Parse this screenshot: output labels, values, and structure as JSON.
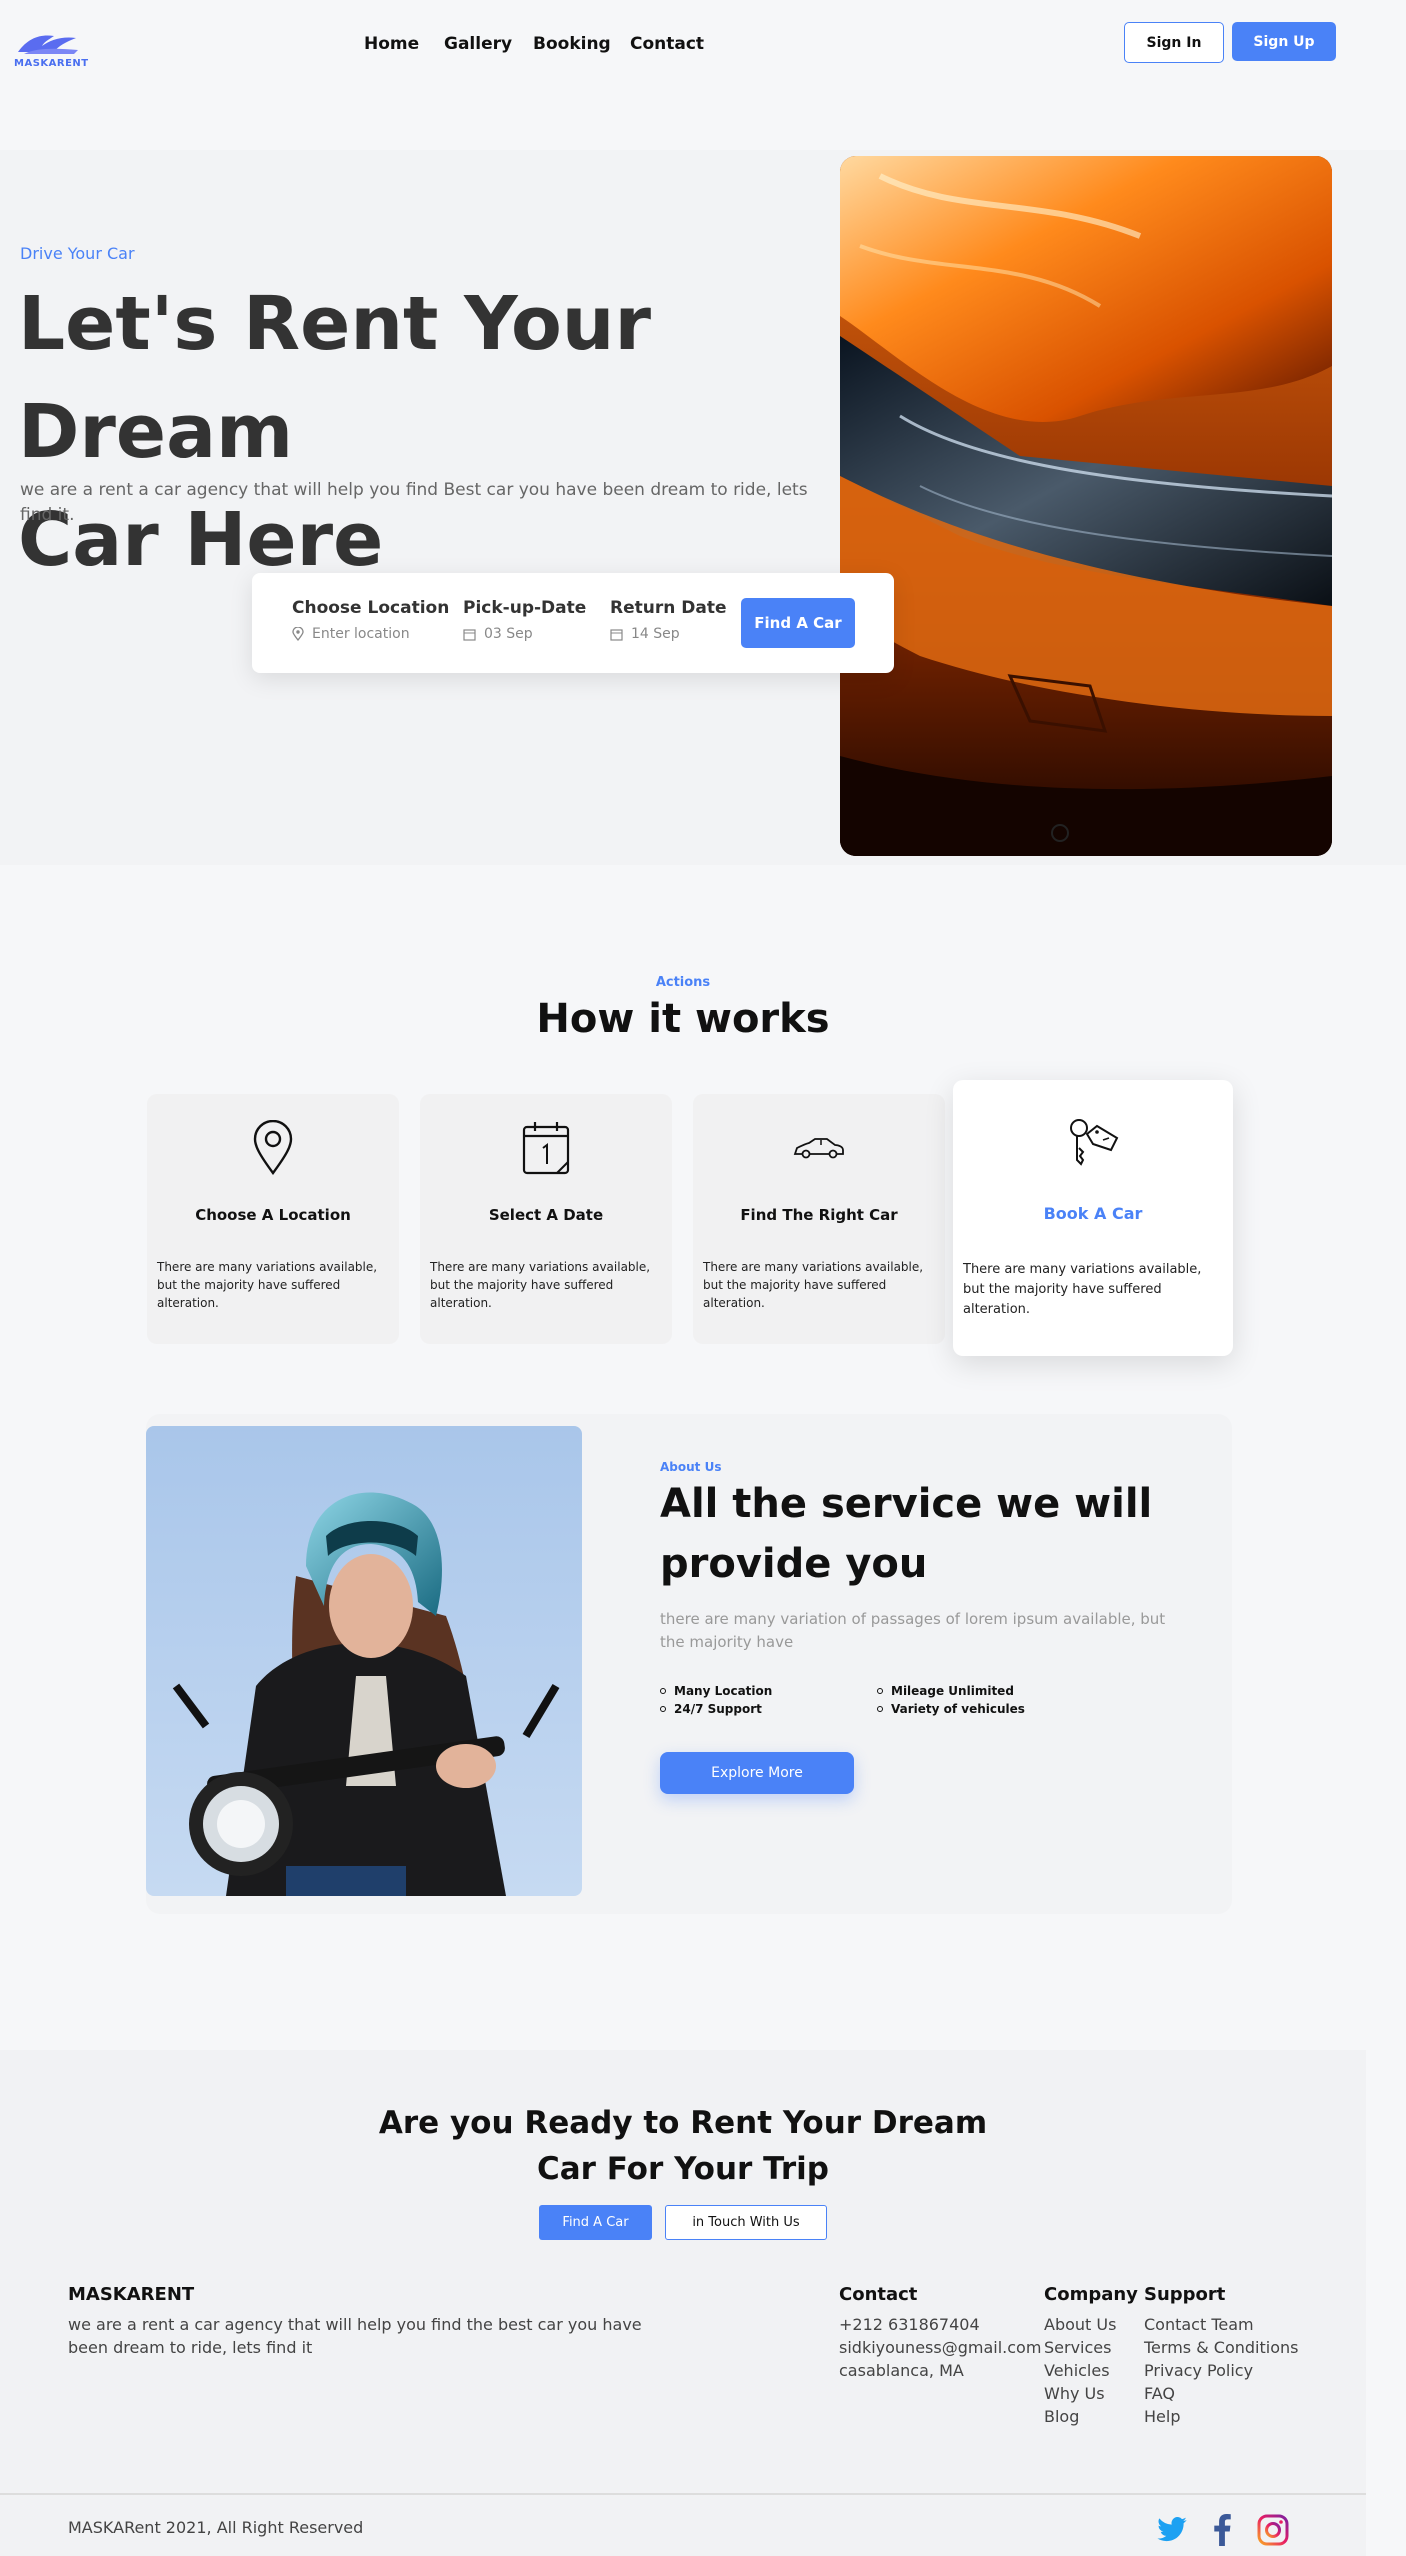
{
  "brand": {
    "name": "MASKARENT"
  },
  "nav": {
    "items": [
      "Home",
      "Gallery",
      "Booking",
      "Contact"
    ],
    "sign_in": "Sign In",
    "sign_up": "Sign Up"
  },
  "hero": {
    "eyebrow": "Drive Your Car",
    "title_line1": "Let's Rent Your Dream",
    "title_line2": "Car Here",
    "description": "we are a rent a car agency that will help you find Best car you have been dream to ride, lets find it.",
    "search": {
      "location_title": "Choose Location",
      "location_placeholder": "Enter location",
      "pickup_title": "Pick-up-Date",
      "pickup_value": "03 Sep",
      "return_title": "Return Date",
      "return_value": "14 Sep",
      "button": "Find A Car"
    }
  },
  "how": {
    "eyebrow": "Actions",
    "title": "How it works",
    "cards": [
      {
        "title": "Choose A Location",
        "desc": "There are many variations available, but the majority have suffered alteration.",
        "icon": "map-pin-icon"
      },
      {
        "title": "Select A Date",
        "desc": "There are many variations available, but the majority have suffered alteration.",
        "icon": "calendar-icon"
      },
      {
        "title": "Find The Right Car",
        "desc": "There are many variations available, but the majority have suffered alteration.",
        "icon": "car-icon"
      },
      {
        "title": "Book A Car",
        "desc": "There are many variations available, but the majority have suffered alteration.",
        "icon": "car-keys-icon"
      }
    ]
  },
  "about": {
    "eyebrow": "About Us",
    "title": "All the service we will provide you",
    "description": "there are many variation of passages of lorem ipsum available, but the majority have",
    "features": [
      "Many Location",
      "24/7 Support",
      "Mileage Unlimited",
      "Variety of vehicules"
    ],
    "button": "Explore More"
  },
  "cta": {
    "title_line1": "Are you Ready to Rent Your Dream",
    "title_line2": "Car For Your Trip",
    "find_button": "Find A Car",
    "touch_button": "in Touch With Us"
  },
  "footer": {
    "brand": "MASKARENT",
    "brand_desc": "we are a rent a car agency that will help you find the best car you have been dream to ride, lets find it",
    "contact": {
      "title": "Contact",
      "items": [
        "+212 631867404",
        "sidkiyouness@gmail.com",
        "casablanca, MA"
      ]
    },
    "company": {
      "title": "Company",
      "items": [
        "About Us",
        "Services",
        "Vehicles",
        "Why Us",
        "Blog"
      ]
    },
    "support": {
      "title": "Support",
      "items": [
        "Contact Team",
        "Terms & Conditions",
        "Privacy Policy",
        "FAQ",
        "Help"
      ]
    },
    "copyright": "MASKARent 2021, All Right Reserved"
  },
  "colors": {
    "accent": "#4a82f7",
    "text_dark": "#111111",
    "hero_text": "#333333",
    "twitter": "#1da1f2",
    "facebook": "#3b5998"
  }
}
